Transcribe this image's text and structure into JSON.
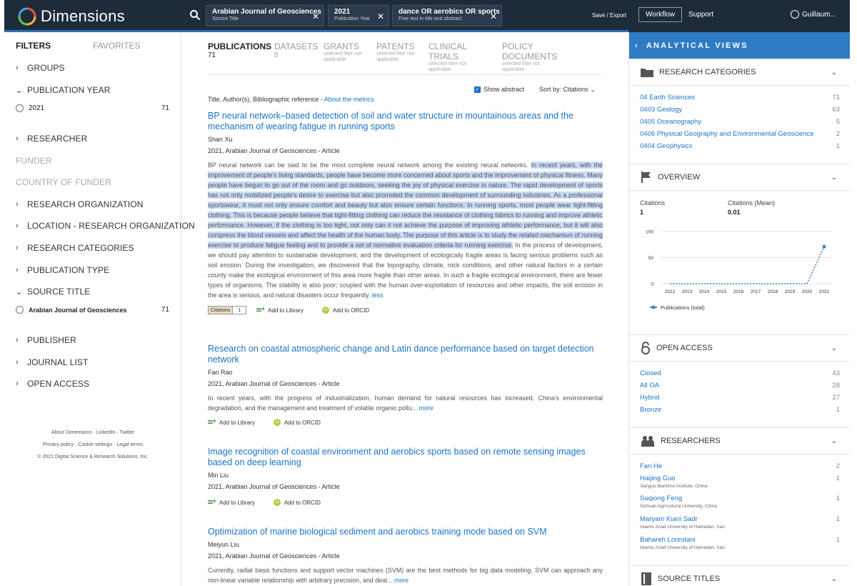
{
  "header": {
    "brand": "Dimensions",
    "chips": [
      {
        "value": "Arabian Journal of Geosciences",
        "label": "Source Title"
      },
      {
        "value": "2021",
        "label": "Publication Year"
      },
      {
        "value": "dance OR aerobics OR sports",
        "label": "Free text in title and abstract"
      }
    ],
    "save_export": "Save / Export",
    "workflow": "Workflow",
    "support": "Support",
    "user": "Guillaum..."
  },
  "filters": {
    "tabs": {
      "filters": "FILTERS",
      "favorites": "FAVORITES"
    },
    "groups": {
      "groups": "GROUPS",
      "publication_year": "PUBLICATION YEAR",
      "researcher": "RESEARCHER",
      "funder": "FUNDER",
      "country_of_funder": "COUNTRY OF FUNDER",
      "research_organization": "RESEARCH ORGANIZATION",
      "location_research_organization": "LOCATION - RESEARCH ORGANIZATION",
      "research_categories": "RESEARCH CATEGORIES",
      "publication_type": "PUBLICATION TYPE",
      "source_title": "SOURCE TITLE",
      "publisher": "PUBLISHER",
      "journal_list": "JOURNAL LIST",
      "open_access": "OPEN ACCESS"
    },
    "year_option": {
      "label": "2021",
      "count": "71"
    },
    "source_option": {
      "label": "Arabian Journal of Geosciences",
      "count": "71"
    },
    "footer": {
      "line1": "About Dimensions · LinkedIn · Twitter",
      "line2": "Privacy policy · Cookie settings · Legal terms",
      "line3": "© 2021 Digital Science & Research Solutions, Inc."
    }
  },
  "tabs": [
    {
      "label": "PUBLICATIONS",
      "count": "71"
    },
    {
      "label": "DATASETS",
      "count": "0"
    },
    {
      "label": "GRANTS",
      "sub": "selected filter not applicable"
    },
    {
      "label": "PATENTS",
      "sub": "selected filter not applicable"
    },
    {
      "label": "CLINICAL TRIALS",
      "sub": "selected filter not applicable"
    },
    {
      "label": "POLICY DOCUMENTS",
      "sub": "selected filter not applicable"
    }
  ],
  "results": {
    "meta_prefix": "Title, Author(s), Bibliographic reference - ",
    "meta_link": "About the metrics",
    "show_abstract": "Show abstract",
    "sort_label": "Sort by:",
    "sort_value": "Citations",
    "add_library": "Add to Library",
    "add_orcid": "Add to ORCID",
    "citations_badge": "Citations",
    "pubs": [
      {
        "title": "BP neural network–based detection of soil and water structure in mountainous areas and the mechanism of wearing fatigue in running sports",
        "author": "Shan Xu",
        "cite": "2021, Arabian Journal of Geosciences - Article",
        "abstract_pre": "BP neural network can be said to be the most complete neural network among the existing neural networks. ",
        "abstract_hl": "In recent years, with the improvement of people's living standards, people have become more concerned about sports and the improvement of physical fitness. Many people have begun to go out of the room and go outdoors, seeking the joy of physical exercise in nature. The rapid development of sports has not only mobilized people's desire to exercise but also promoted the common development of surrounding industries. As a professional sportswear, it must not only ensure comfort and beauty but also ensure certain functions. In running sports, most people wear tight-fitting clothing. This is because people believe that tight-fitting clothing can reduce the resistance of clothing fabrics to running and improve athletic performance. However, if the clothing is too tight, not only can it not achieve the purpose of improving athletic performance, but it will also compress the blood vessels and affect the health of the human body. The purpose of this article is to study the related mechanism of running exercise to produce fatigue feeling and to provide a set of normative evaluation criteria for running exercise.",
        "abstract_post": " In the process of development, we should pay attention to sustainable development, and the development of ecologically fragile areas is facing serious problems such as soil erosion. During the investigation, we discovered that the topography, climate, rock conditions, and other natural factors in a certain county make the ecological environment of this area more fragile than other areas. In such a fragile ecological environment, there are fewer types of organisms. The stability is also poor; coupled with the human over-exploitation of resources and other impacts, the soil erosion in the area is serious, and natural disasters occur frequently. ",
        "toggle": "less",
        "citations": "1"
      },
      {
        "title": "Research on coastal atmospheric change and Latin dance performance based on target detection network",
        "author": "Fan Rao",
        "cite": "2021, Arabian Journal of Geosciences - Article",
        "abstract": "In recent years, with the progress of industrialization, human demand for natural resources has increased, China's environmental degradation, and the management and treatment of volatile organic pollu... ",
        "toggle": "more"
      },
      {
        "title": "Image recognition of coastal environment and aerobics sports based on remote sensing images based on deep learning",
        "author": "Min Liu",
        "cite": "2021, Arabian Journal of Geosciences - Article"
      },
      {
        "title": "Optimization of marine biological sediment and aerobics training mode based on SVM",
        "author": "Meiyun Liu",
        "cite": "2021, Arabian Journal of Geosciences - Article",
        "abstract": "Currently, radial basis functions and support vector machines (SVM) are the best methods for big data modeling. SVM can approach any non-linear variable relationship with arbitrary precision, and deal... ",
        "toggle": "more"
      }
    ]
  },
  "analytics": {
    "header": "ANALYTICAL VIEWS",
    "research_categories": {
      "title": "RESEARCH CATEGORIES",
      "items": [
        {
          "name": "04 Earth Sciences",
          "count": "71"
        },
        {
          "name": "0403 Geology",
          "count": "63"
        },
        {
          "name": "0405 Oceanography",
          "count": "5"
        },
        {
          "name": "0406 Physical Geography and Environmental Geoscience",
          "count": "2"
        },
        {
          "name": "0404 Geophysics",
          "count": "1"
        }
      ]
    },
    "overview": {
      "title": "OVERVIEW",
      "citations_label": "Citations",
      "citations_value": "1",
      "mean_label": "Citations (Mean)",
      "mean_value": "0.01",
      "legend": "Publications (total)"
    },
    "open_access": {
      "title": "OPEN ACCESS",
      "items": [
        {
          "name": "Closed",
          "count": "43"
        },
        {
          "name": "All OA",
          "count": "28"
        },
        {
          "name": "Hybrid",
          "count": "27"
        },
        {
          "name": "Bronze",
          "count": "1"
        }
      ]
    },
    "researchers": {
      "title": "RESEARCHERS",
      "items": [
        {
          "name": "Fan He",
          "aff": "",
          "count": "2"
        },
        {
          "name": "Haijing Guo",
          "aff": "Jiangsu Maritime Institute, China",
          "count": "1"
        },
        {
          "name": "Suqiong Feng",
          "aff": "Sichuan Agricultural University, China",
          "count": "1"
        },
        {
          "name": "Maryam Kiani Sadr",
          "aff": "Islamic Azad University of Hamedan, Iran",
          "count": "1"
        },
        {
          "name": "Bahareh Lorestani",
          "aff": "Islamic Azad University of Hamedan, Iran",
          "count": "1"
        }
      ]
    },
    "source_titles": {
      "title": "SOURCE TITLES"
    }
  },
  "chart_data": {
    "type": "line",
    "x": [
      "2012",
      "2013",
      "2014",
      "2015",
      "2016",
      "2017",
      "2018",
      "2019",
      "2020",
      "2021"
    ],
    "series": [
      {
        "name": "Publications (total)",
        "values": [
          0,
          0,
          0,
          0,
          0,
          0,
          0,
          0,
          0,
          71
        ],
        "color": "#3a86d0"
      }
    ],
    "yticks": [
      "0",
      "50",
      "100"
    ],
    "ylim": [
      0,
      100
    ],
    "grid": true,
    "legend": "bottom"
  }
}
